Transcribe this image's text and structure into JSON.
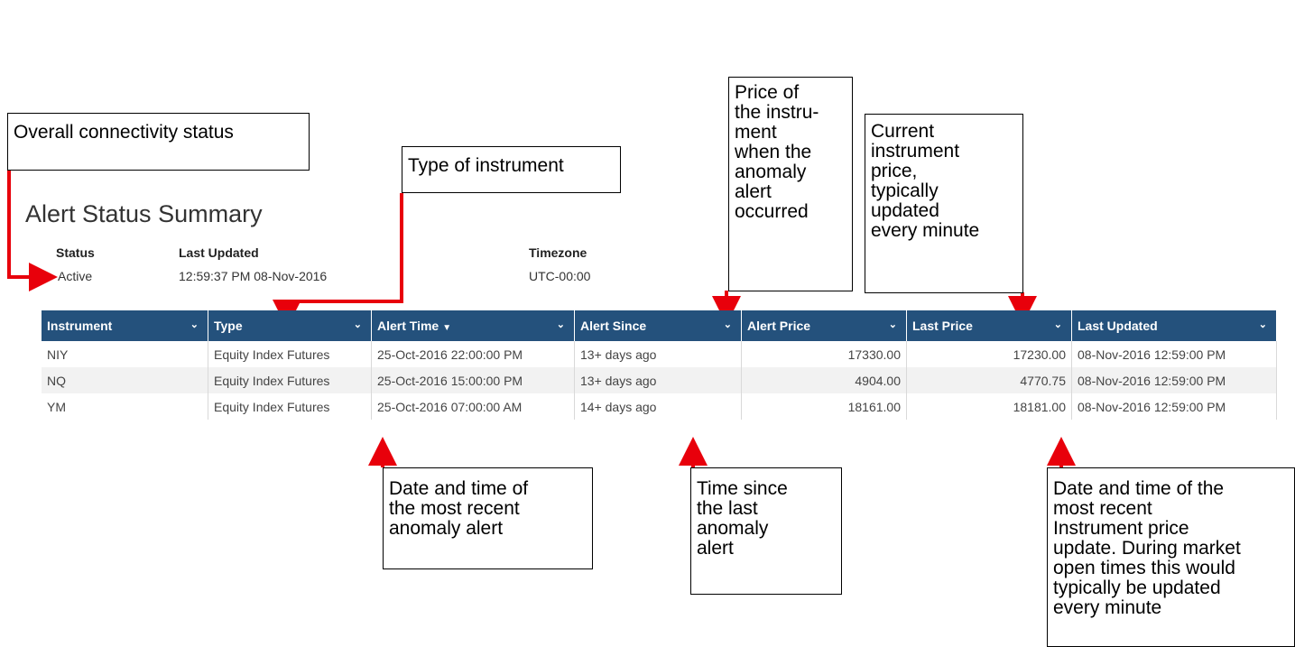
{
  "page": {
    "title": "Alert Status Summary"
  },
  "summary": {
    "status_label": "Status",
    "status_value": "Active",
    "last_updated_label": "Last Updated",
    "last_updated_value": "12:59:37 PM 08-Nov-2016",
    "timezone_label": "Timezone",
    "timezone_value": "UTC-00:00"
  },
  "table": {
    "columns": [
      {
        "label": "Instrument"
      },
      {
        "label": "Type"
      },
      {
        "label": "Alert Time",
        "sorted": "descending"
      },
      {
        "label": "Alert Since"
      },
      {
        "label": "Alert Price"
      },
      {
        "label": "Last Price"
      },
      {
        "label": "Last Updated"
      }
    ],
    "rows": [
      [
        "NIY",
        "Equity Index Futures",
        "25-Oct-2016 22:00:00 PM",
        "13+ days ago",
        "17330.00",
        "17230.00",
        "08-Nov-2016 12:59:00 PM"
      ],
      [
        "NQ",
        "Equity Index Futures",
        "25-Oct-2016 15:00:00 PM",
        "13+ days ago",
        "4904.00",
        "4770.75",
        "08-Nov-2016 12:59:00 PM"
      ],
      [
        "YM",
        "Equity Index Futures",
        "25-Oct-2016 07:00:00 AM",
        "14+ days ago",
        "18161.00",
        "18181.00",
        "08-Nov-2016 12:59:00 PM"
      ]
    ],
    "header_color": "#24517c"
  },
  "callouts": {
    "connectivity": "Overall connectivity status",
    "type": "Type of instrument",
    "alert_price": "Price of\nthe instru-\nment\nwhen the\nanomaly\nalert\noccurred",
    "last_price": "Current\ninstrument\nprice,\ntypically\nupdated\nevery minute",
    "alert_time": "Date and time of\nthe most recent\nanomaly alert",
    "alert_since": "Time since\nthe last\nanomaly\nalert",
    "last_updated": "Date and time of the\nmost recent\nInstrument price\nupdate. During market\nopen times this would\ntypically be updated\nevery minute"
  },
  "icons": {
    "dropdown": "chevron-down-icon",
    "sort": "sort-descending-icon"
  },
  "arrow_color": "#e8000b"
}
